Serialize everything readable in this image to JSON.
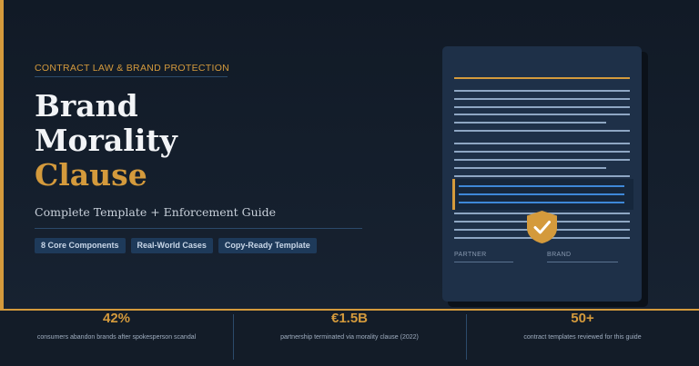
{
  "hero": {
    "kicker": "CONTRACT LAW & BRAND PROTECTION",
    "title_line1": "Brand",
    "title_line2": "Morality",
    "title_line3": "Clause",
    "subtitle": "Complete Template + Enforcement Guide",
    "tags": [
      "8 Core Components",
      "Real-World Cases",
      "Copy-Ready Template"
    ]
  },
  "document": {
    "signature_left": "PARTNER",
    "signature_right": "BRAND",
    "badge_icon": "shield-check-icon"
  },
  "stats": [
    {
      "value": "42%",
      "label": "consumers abandon brands after spokesperson scandal"
    },
    {
      "value": "€1.5B",
      "label": "partnership terminated via morality clause (2022)"
    },
    {
      "value": "50+",
      "label": "contract templates reviewed for this guide"
    }
  ],
  "colors": {
    "accent": "#d49a3c",
    "background": "#131c28",
    "document": "#1e3048",
    "tag": "#1e3a5a"
  }
}
